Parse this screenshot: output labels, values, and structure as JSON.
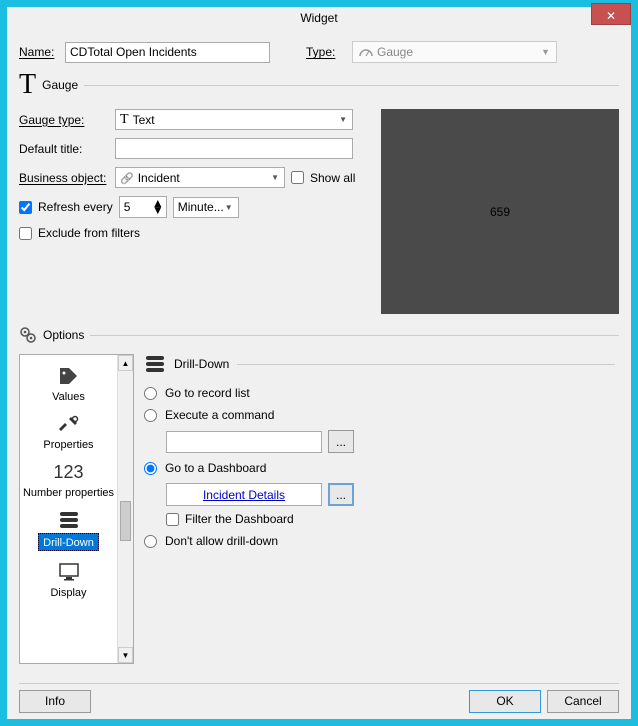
{
  "window": {
    "title": "Widget",
    "close": "✕"
  },
  "header": {
    "name_label": "Name:",
    "name_value": "CDTotal Open Incidents",
    "type_label": "Type:",
    "type_value": "Gauge"
  },
  "gauge": {
    "section_label": "Gauge",
    "gauge_type_label": "Gauge type:",
    "gauge_type_value": "Text",
    "default_title_label": "Default title:",
    "default_title_value": "",
    "business_object_label": "Business object:",
    "business_object_value": "Incident",
    "show_all_label": "Show all",
    "refresh_label": "Refresh every",
    "refresh_value": "5",
    "refresh_unit": "Minute...",
    "exclude_label": "Exclude from filters",
    "preview_value": "659"
  },
  "options": {
    "section_label": "Options",
    "sidebar": {
      "values": "Values",
      "properties": "Properties",
      "number_props_num": "123",
      "number_props": "Number properties",
      "drilldown": "Drill-Down",
      "display": "Display"
    },
    "drilldown": {
      "header": "Drill-Down",
      "go_record": "Go to record list",
      "execute_cmd": "Execute a command",
      "cmd_value": "",
      "go_dashboard": "Go to a Dashboard",
      "dashboard_name": "Incident Details",
      "filter_dashboard": "Filter the Dashboard",
      "dont_allow": "Don't allow drill-down",
      "browse": "..."
    }
  },
  "footer": {
    "info": "Info",
    "ok": "OK",
    "cancel": "Cancel"
  }
}
